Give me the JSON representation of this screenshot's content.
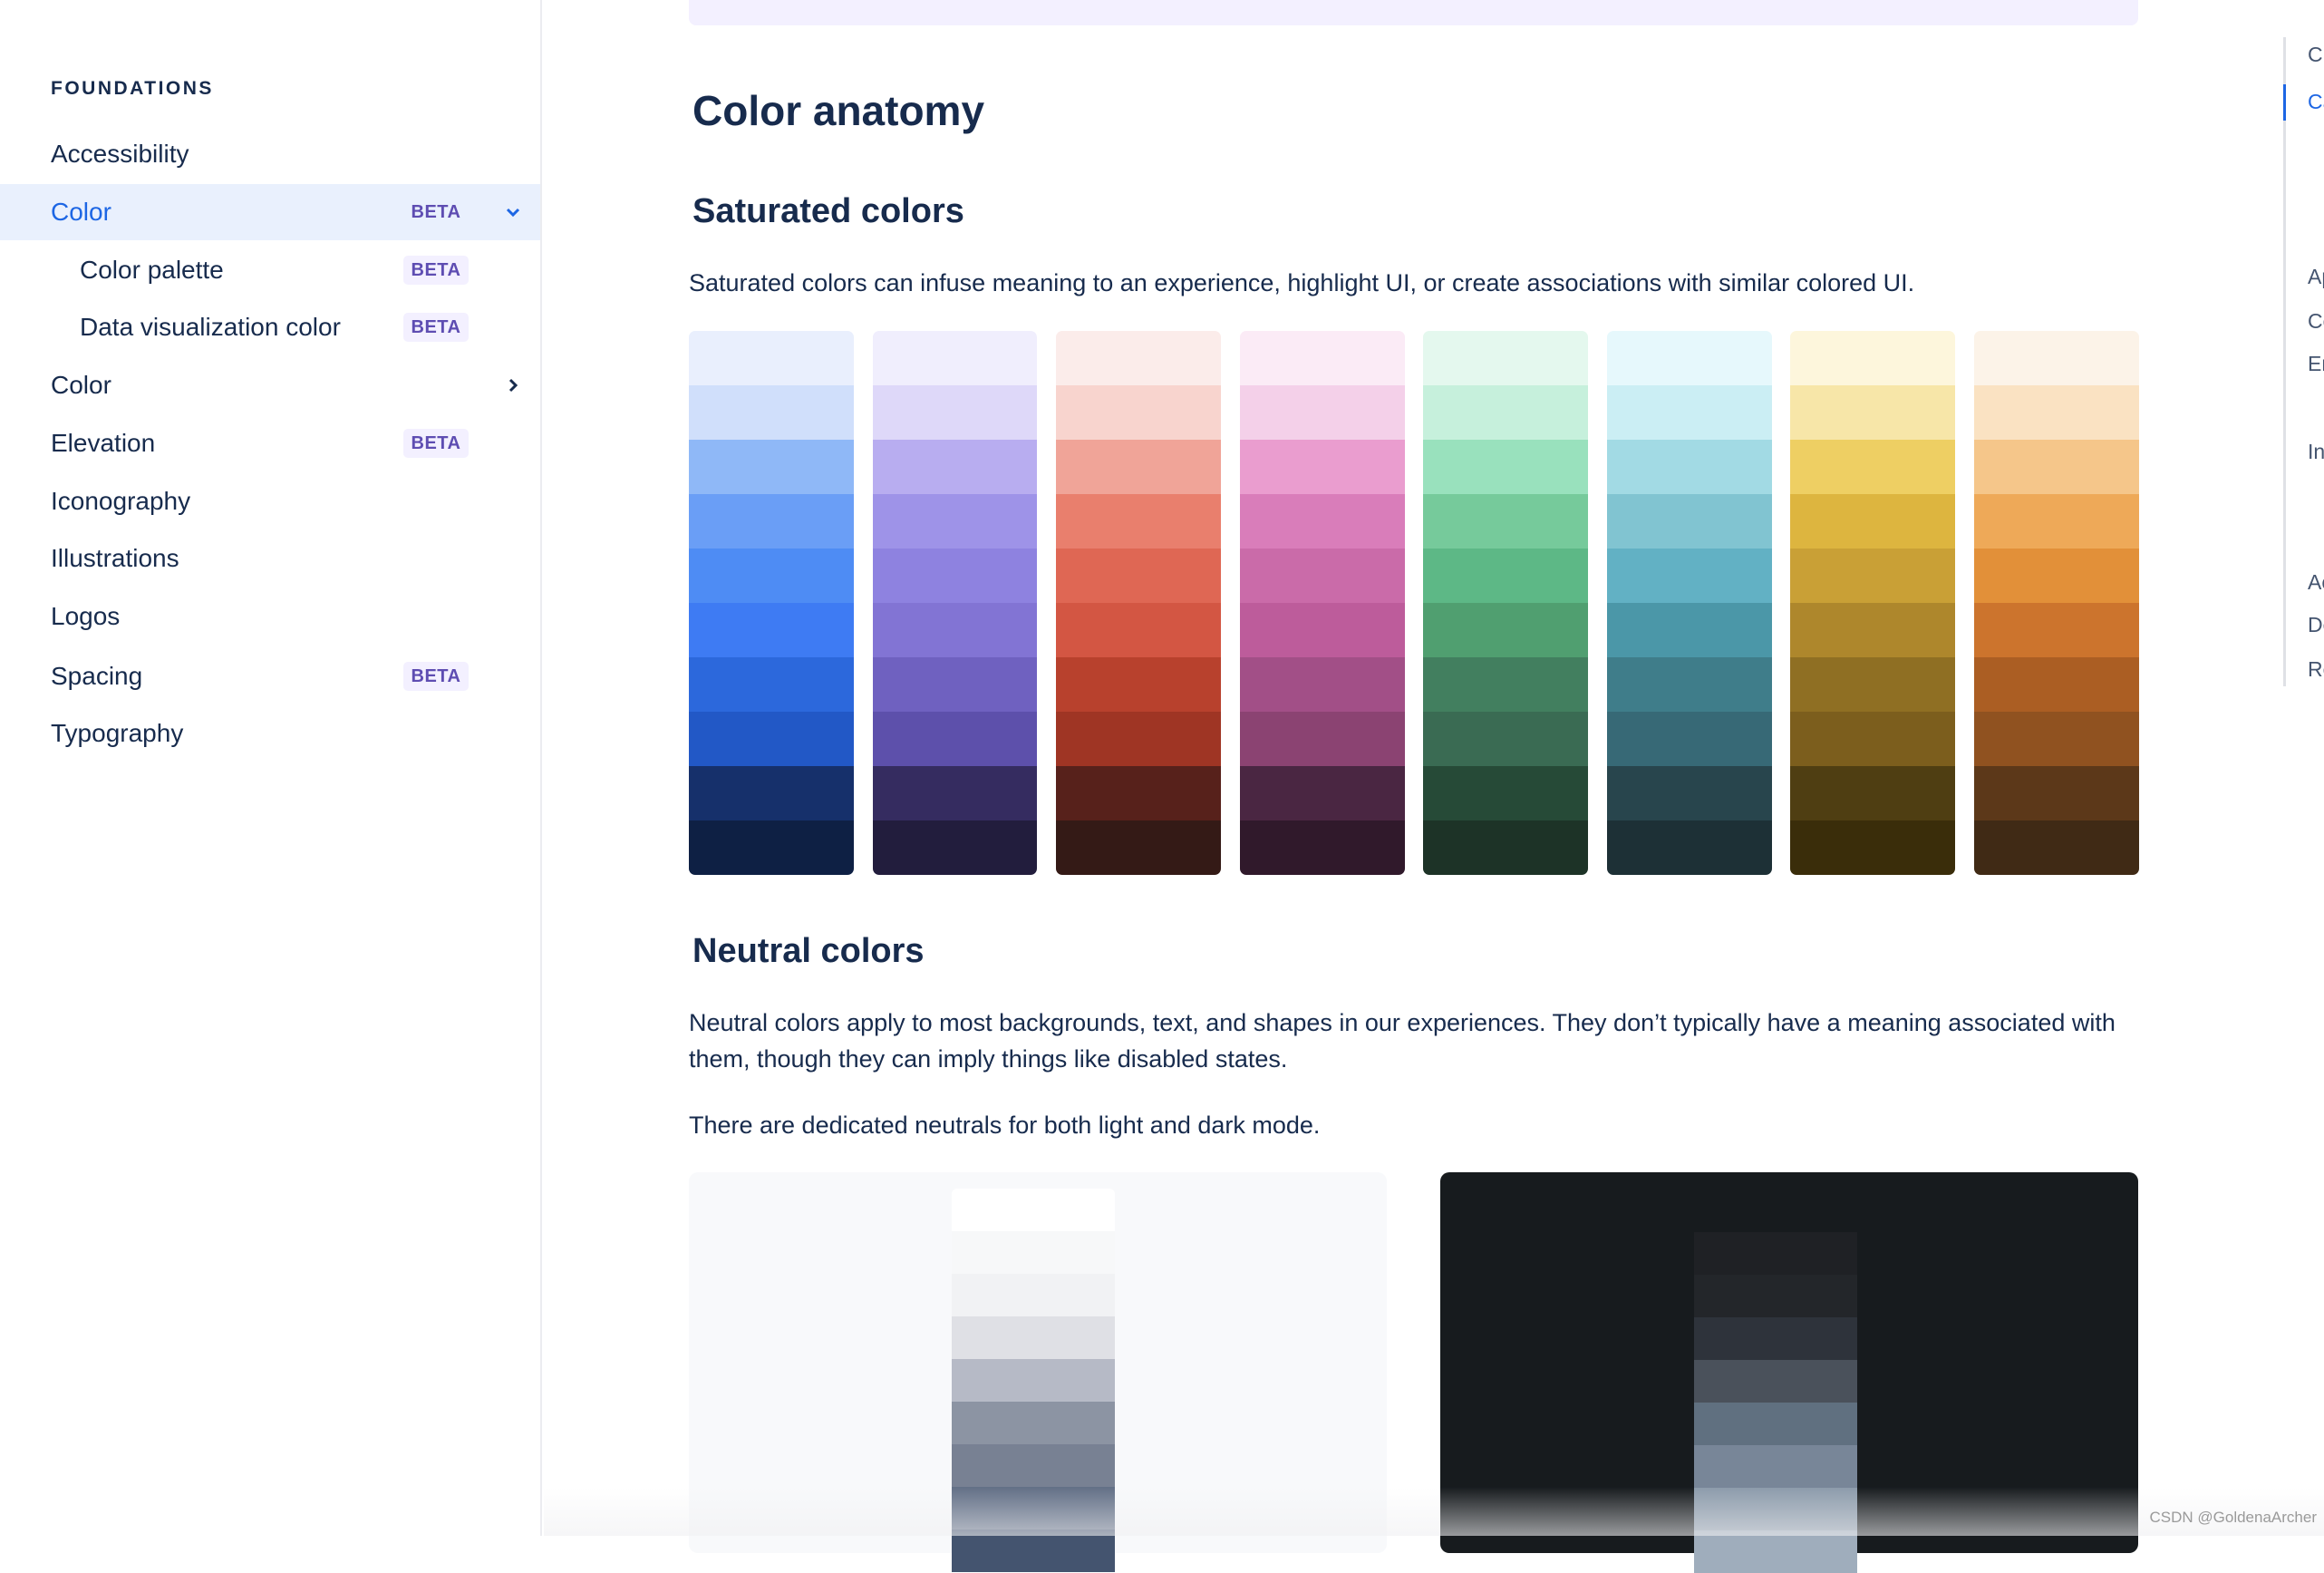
{
  "sidebar": {
    "heading": "FOUNDATIONS",
    "items": [
      {
        "label": "Accessibility",
        "badge": null
      },
      {
        "label": "Color",
        "badge": "BETA",
        "active": true,
        "expanded": true
      },
      {
        "label": "Color palette",
        "badge": "BETA",
        "sub": true
      },
      {
        "label": "Data visualization color",
        "badge": "BETA",
        "sub": true
      },
      {
        "label": "Color",
        "badge": null,
        "chevron": "chevron-right"
      },
      {
        "label": "Elevation",
        "badge": "BETA"
      },
      {
        "label": "Iconography",
        "badge": null
      },
      {
        "label": "Illustrations",
        "badge": null
      },
      {
        "label": "Logos",
        "badge": null
      },
      {
        "label": "Spacing",
        "badge": "BETA"
      },
      {
        "label": "Typography",
        "badge": null
      }
    ]
  },
  "main": {
    "title": "Color anatomy",
    "saturated": {
      "heading": "Saturated colors",
      "description": "Saturated colors can infuse meaning to an experience, highlight UI, or create associations with similar colored UI.",
      "palettes": [
        [
          "#e9effd",
          "#d0dffb",
          "#8fb8f7",
          "#6a9ef6",
          "#4e8cf4",
          "#3e7bf3",
          "#2c68dc",
          "#2258c6",
          "#16306b",
          "#0e2044"
        ],
        [
          "#f0eefd",
          "#ded8f9",
          "#b8adf0",
          "#9e93e8",
          "#8e82e0",
          "#8274d4",
          "#6f61c0",
          "#5d50ab",
          "#352c60",
          "#221d3d"
        ],
        [
          "#fbecea",
          "#f8d4ce",
          "#f0a498",
          "#e97f6d",
          "#df6754",
          "#d35643",
          "#b8412d",
          "#9f3524",
          "#57211b",
          "#341a16"
        ],
        [
          "#fbebf6",
          "#f4d0e9",
          "#ea9dcf",
          "#d97dba",
          "#ca6ba9",
          "#bd5c9b",
          "#a24f87",
          "#8b4372",
          "#4a2642",
          "#30192b"
        ],
        [
          "#e4f8ee",
          "#c6f0dc",
          "#99e1bd",
          "#76ca9b",
          "#5db886",
          "#509f70",
          "#427f5f",
          "#3a6b53",
          "#264a37",
          "#1d3327"
        ],
        [
          "#e6f8fc",
          "#cbeef4",
          "#a2dae4",
          "#81c4d1",
          "#62b1c4",
          "#4b97a8",
          "#3f7d8a",
          "#376976",
          "#28454d",
          "#1d3036"
        ],
        [
          "#fdf6dc",
          "#f7e6a8",
          "#eecf63",
          "#ddb53f",
          "#c9a036",
          "#ae872c",
          "#8f6f23",
          "#7c5e1d",
          "#4f3e12",
          "#3a2d0a"
        ],
        [
          "#fcf3e8",
          "#fae2c2",
          "#f5c68a",
          "#eea958",
          "#e29039",
          "#cc742d",
          "#ab5e23",
          "#905220",
          "#5c3819",
          "#402a15"
        ]
      ]
    },
    "neutral": {
      "heading": "Neutral colors",
      "description": "Neutral colors apply to most backgrounds, text, and shapes in our experiences. They don’t typically have a meaning associated with them, though they can imply things like disabled states.",
      "note": "There are dedicated neutrals for both light and dark mode.",
      "light": [
        "#ffffff",
        "#f7f8f9",
        "#f1f2f4",
        "#dfe0e5",
        "#b6bac6",
        "#8c94a3",
        "#788193",
        "#626f86",
        "#44546f"
      ],
      "dark": [
        "#1f2125",
        "#23262a",
        "#2e333b",
        "#4a515b",
        "#607080",
        "#788698",
        "#8c9bab",
        "#9fadbc"
      ]
    }
  },
  "toc": {
    "items": [
      "C",
      "Ca",
      "Ap",
      "Co",
      "En",
      "In",
      "Ac",
      "De",
      "Re"
    ],
    "active_index": 1
  },
  "watermark": "CSDN @GoldenaArcher",
  "colors": {
    "accent": "#1d66e4",
    "active_bg": "#e9f0fd",
    "badge_bg": "#f3f0ff",
    "badge_text": "#5e4db2",
    "text": "#172b4d"
  }
}
